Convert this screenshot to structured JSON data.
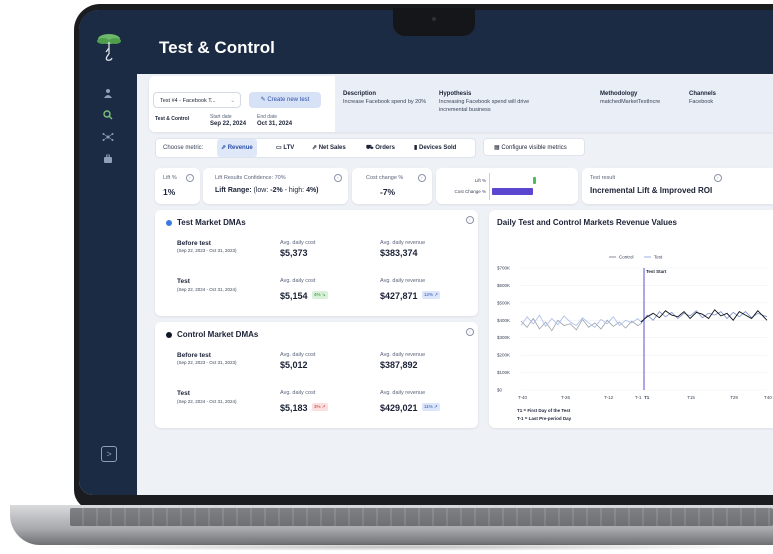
{
  "app": {
    "title": "Test & Control",
    "colors": {
      "sidebar": "#1b2b44",
      "accent": "#4b39c8",
      "test_line": "#9bb0e0",
      "control_line": "#8a8f99"
    }
  },
  "sidebar": {
    "icons": [
      "user-icon",
      "search-icon",
      "network-icon",
      "briefcase-icon"
    ],
    "expand_label": ">"
  },
  "test_selector": {
    "value": "Test #4 - Facebook T...",
    "caret": "⌄"
  },
  "create_button": {
    "label": "Create new test"
  },
  "test_meta": {
    "type": "Test & Control",
    "start_label": "Start date",
    "start_value": "Sep 22, 2024",
    "end_label": "End date",
    "end_value": "Oct 31, 2024"
  },
  "info": {
    "description_label": "Description",
    "description_text": "Increase Facebook spend by 20%",
    "hypothesis_label": "Hypothesis",
    "hypothesis_text": "Increasing Facebook spend will drive incremental business",
    "methodology_label": "Methodology",
    "methodology_text": "matchedMarketTestIncre",
    "channels_label": "Channels",
    "channels_text": "Facebook"
  },
  "metrics": {
    "prefix": "Choose metric:",
    "items": [
      "Revenue",
      "LTV",
      "Net Sales",
      "Orders",
      "Devices Sold"
    ],
    "active": "Revenue",
    "configure_label": "Configure visible metrics"
  },
  "kpis": {
    "lift_label": "Lift %",
    "lift_value": "1%",
    "confidence_label": "Lift Results Confidence: 70%",
    "range_prefix": "Lift Range:",
    "range_low": "(low: ",
    "range_low_val": "-2%",
    "range_high": " - high: ",
    "range_high_val": "4%)",
    "cost_label": "Cost change %",
    "cost_value": "-7%",
    "mini_lift_label": "Lift %",
    "mini_cost_label": "Cost Change %",
    "result_label": "Test result",
    "result_value": "Incremental Lift & Improved ROI"
  },
  "test_markets": {
    "title": "Test Market DMAs",
    "before_label": "Before test",
    "before_dates": "(Sep 22, 2023 - Oct 31, 2023)",
    "test_label": "Test",
    "test_dates": "(Sep 22, 2024 - Oct 31, 2024)",
    "cost_label": "Avg. daily cost",
    "revenue_label": "Avg. daily revenue",
    "before_cost": "$5,373",
    "before_revenue": "$383,374",
    "test_cost": "$5,154",
    "test_cost_badge": "4% ↘",
    "test_revenue": "$427,871",
    "test_revenue_badge": "12% ↗"
  },
  "control_markets": {
    "title": "Control Market DMAs",
    "before_label": "Before test",
    "before_dates": "(Sep 22, 2023 - Oct 31, 2023)",
    "test_label": "Test",
    "test_dates": "(Sep 22, 2024 - Oct 31, 2024)",
    "cost_label": "Avg. daily cost",
    "revenue_label": "Avg. daily revenue",
    "before_cost": "$5,012",
    "before_revenue": "$387,892",
    "test_cost": "$5,183",
    "test_cost_badge": "3% ↗",
    "test_revenue": "$429,021",
    "test_revenue_badge": "11% ↗"
  },
  "chart": {
    "title": "Daily Test and Control Markets Revenue Values",
    "legend": [
      "Control",
      "Test"
    ],
    "marker_label": "Test Start",
    "foot1": "T1 = First Day of the Test",
    "foot2": "T-1 = Last Pre-period Day"
  },
  "chart_data": {
    "type": "line",
    "title": "Daily Test and Control Markets Revenue Values",
    "ylim": [
      0,
      700000
    ],
    "yticks": [
      "$0",
      "$100K",
      "$200K",
      "$300K",
      "$400K",
      "$500K",
      "$600K",
      "$700K"
    ],
    "xticks": [
      "T-40",
      "T-26",
      "T-12",
      "T-1",
      "T1",
      "T15",
      "T29",
      "T40"
    ],
    "x": [
      -40,
      -38,
      -36,
      -34,
      -32,
      -30,
      -28,
      -26,
      -24,
      -22,
      -20,
      -18,
      -16,
      -14,
      -12,
      -10,
      -8,
      -6,
      -4,
      -2,
      -1,
      1,
      3,
      5,
      7,
      9,
      11,
      13,
      15,
      17,
      19,
      21,
      23,
      25,
      27,
      29,
      31,
      33,
      35,
      37,
      40
    ],
    "series": [
      {
        "name": "Control",
        "values": [
          395000,
          360000,
          410000,
          350000,
          390000,
          340000,
          400000,
          370000,
          380000,
          345000,
          405000,
          360000,
          385000,
          350000,
          400000,
          365000,
          390000,
          355000,
          395000,
          370000,
          380000,
          430000,
          400000,
          450000,
          420000,
          445000,
          410000,
          440000,
          425000,
          455000,
          415000,
          440000,
          430000,
          450000,
          410000,
          445000,
          420000,
          450000,
          415000,
          440000,
          420000
        ]
      },
      {
        "name": "Test",
        "values": [
          370000,
          420000,
          380000,
          430000,
          365000,
          410000,
          375000,
          425000,
          390000,
          370000,
          415000,
          385000,
          360000,
          405000,
          380000,
          420000,
          370000,
          400000,
          385000,
          410000,
          390000,
          420000,
          440000,
          415000,
          455000,
          430000,
          420000,
          450000,
          410000,
          445000,
          435000,
          410000,
          460000,
          425000,
          440000,
          400000,
          450000,
          430000,
          410000,
          455000,
          400000
        ]
      }
    ],
    "marker": "T1"
  }
}
